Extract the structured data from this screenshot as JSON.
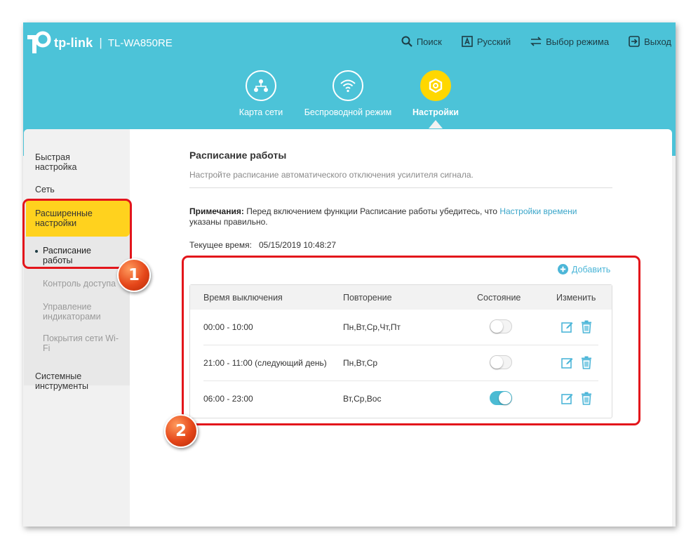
{
  "header": {
    "brand": "tp-link",
    "model": "TL-WA850RE",
    "toplinks": [
      {
        "label": "Поиск",
        "icon": "search-icon"
      },
      {
        "label": "Русский",
        "icon": "language-icon"
      },
      {
        "label": "Выбор режима",
        "icon": "mode-switch-icon"
      },
      {
        "label": "Выход",
        "icon": "logout-icon"
      }
    ],
    "nav": [
      {
        "label": "Карта сети",
        "icon": "network-map-icon"
      },
      {
        "label": "Беспроводной режим",
        "icon": "wireless-icon"
      },
      {
        "label": "Настройки",
        "icon": "settings-icon",
        "active": true
      }
    ]
  },
  "sidebar": {
    "items": [
      {
        "label_line1": "Быстрая",
        "label_line2": "настройка"
      },
      {
        "label": "Сеть"
      },
      {
        "label_line1": "Расширенные",
        "label_line2": "настройки",
        "active": true
      },
      {
        "label_line1": "Системные",
        "label_line2": "инструменты"
      }
    ],
    "subitems": [
      {
        "label_line1": "Расписание",
        "label_line2": "работы",
        "current": true
      },
      {
        "label": "Контроль доступа"
      },
      {
        "label_line1": "Управление",
        "label_line2": "индикаторами"
      },
      {
        "label_line1": "Покрытия сети Wi-",
        "label_line2": "Fi"
      }
    ]
  },
  "main": {
    "title": "Расписание работы",
    "subtitle": "Настройте расписание автоматического отключения усилителя сигнала.",
    "note_label": "Примечания:",
    "note_text": "Перед включением функции Расписание работы убедитесь, что",
    "note_link": "Настройки времени",
    "note_text2": "указаны правильно.",
    "current_time_label": "Текущее время:",
    "current_time_value": "05/15/2019 10:48:27",
    "add_label": "Добавить",
    "table": {
      "headers": [
        "Время выключения",
        "Повторение",
        "Состояние",
        "Изменить"
      ],
      "rows": [
        {
          "time": "00:00 - 10:00",
          "repeat": "Пн,Вт,Ср,Чт,Пт",
          "enabled": false
        },
        {
          "time": "21:00 - 11:00 (следующий день)",
          "repeat": "Пн,Вт,Ср",
          "enabled": false
        },
        {
          "time": "06:00 - 23:00",
          "repeat": "Вт,Ср,Вос",
          "enabled": true
        }
      ]
    }
  },
  "annotations": {
    "badge1": "1",
    "badge2": "2"
  },
  "colors": {
    "header": "#4cc3d8",
    "accent_yellow": "#ffd21e",
    "link": "#39a5c9",
    "highlight_red": "#e3151b"
  }
}
